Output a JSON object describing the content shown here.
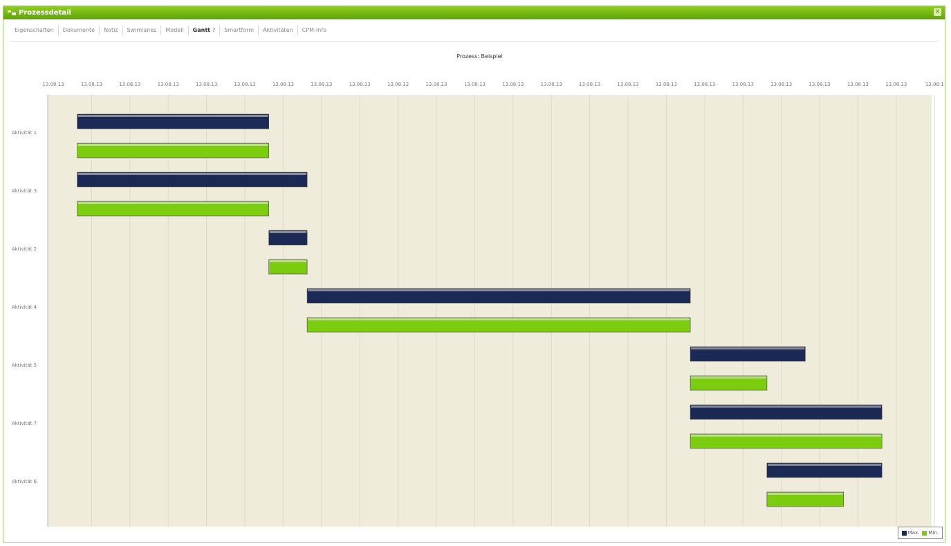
{
  "window": {
    "title": "Prozessdetail",
    "close_glyph": "×",
    "icons": {
      "window": "window-icon",
      "close": "close-icon"
    }
  },
  "tabs": [
    {
      "label": "Eigenschaften",
      "active": false
    },
    {
      "label": "Dokumente",
      "active": false
    },
    {
      "label": "Notiz",
      "active": false
    },
    {
      "label": "Swimlanes",
      "active": false
    },
    {
      "label": "Modell",
      "active": false
    },
    {
      "label": "Gantt",
      "active": true,
      "icon": "help-icon",
      "icon_glyph": "?"
    },
    {
      "label": "Smartform",
      "active": false
    },
    {
      "label": "Aktivitäten",
      "active": false
    },
    {
      "label": "CPM-Info",
      "active": false
    }
  ],
  "colors": {
    "max": "#1a2a55",
    "min": "#7ccc10",
    "plot_bg": "#efecdc",
    "grid": "#dcdac8"
  },
  "chart_data": {
    "type": "gantt",
    "title": "Prozess: Beispiel",
    "x_tick_labels": [
      "13.08.13",
      "13.08.13",
      "13.08.13",
      "13.08.13",
      "13.08.13",
      "13.08.13",
      "13.08.13",
      "13.08.13",
      "13.08.13",
      "13.08.12",
      "13.08.13",
      "13.08.13",
      "13.08.13",
      "13.08.13",
      "13.08.13",
      "13.08.13",
      "13.08.13",
      "13.08.13",
      "13.08.13",
      "13.08.13",
      "13.08.13",
      "13.08.13",
      "13.08.13",
      "13.08.1"
    ],
    "categories": [
      "Aktivität 1",
      "Aktivität 3",
      "Aktivität 2",
      "Aktivität 4",
      "Aktivität 5",
      "Aktivität 7",
      "Aktivität 6"
    ],
    "series": [
      {
        "name": "Max.",
        "color": "#1a2a55",
        "tasks": [
          [
            1,
            6
          ],
          [
            1,
            7
          ],
          [
            6,
            7
          ],
          [
            7,
            17
          ],
          [
            17,
            20
          ],
          [
            17,
            22
          ],
          [
            19,
            22
          ]
        ]
      },
      {
        "name": "Min.",
        "color": "#7ccc10",
        "tasks": [
          [
            1,
            6
          ],
          [
            1,
            6
          ],
          [
            6,
            7
          ],
          [
            7,
            17
          ],
          [
            17,
            19
          ],
          [
            17,
            22
          ],
          [
            19,
            21
          ]
        ]
      }
    ],
    "grid": true,
    "legend": "bottom-right"
  }
}
